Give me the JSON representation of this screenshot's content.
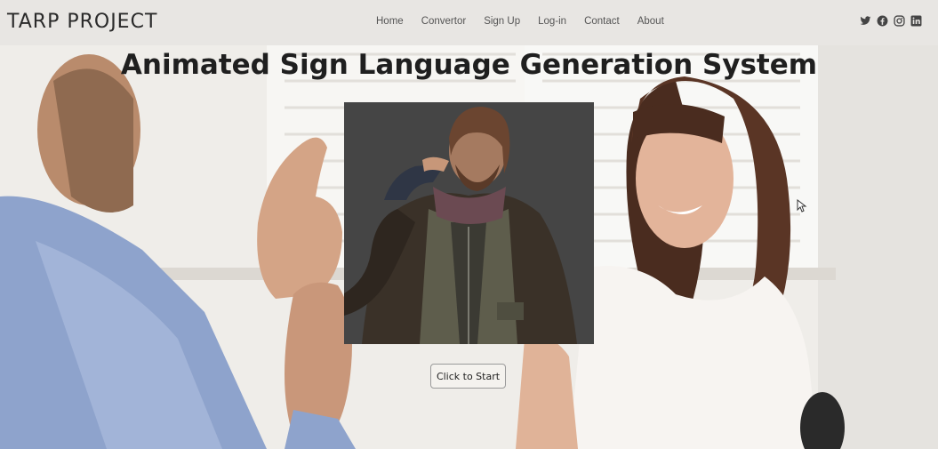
{
  "brand": "TARP PROJECT",
  "nav": {
    "links": [
      {
        "label": "Home"
      },
      {
        "label": "Convertor"
      },
      {
        "label": "Sign Up"
      },
      {
        "label": "Log-in"
      },
      {
        "label": "Contact"
      },
      {
        "label": "About"
      }
    ],
    "socials": [
      "twitter-icon",
      "facebook-icon",
      "instagram-icon",
      "linkedin-icon"
    ]
  },
  "hero": {
    "title": "Animated Sign Language Generation System",
    "start_button": "Click to Start"
  },
  "colors": {
    "navbar_bg": "#e8e6e3",
    "video_bg": "#454545",
    "text": "#1f1f1f"
  }
}
